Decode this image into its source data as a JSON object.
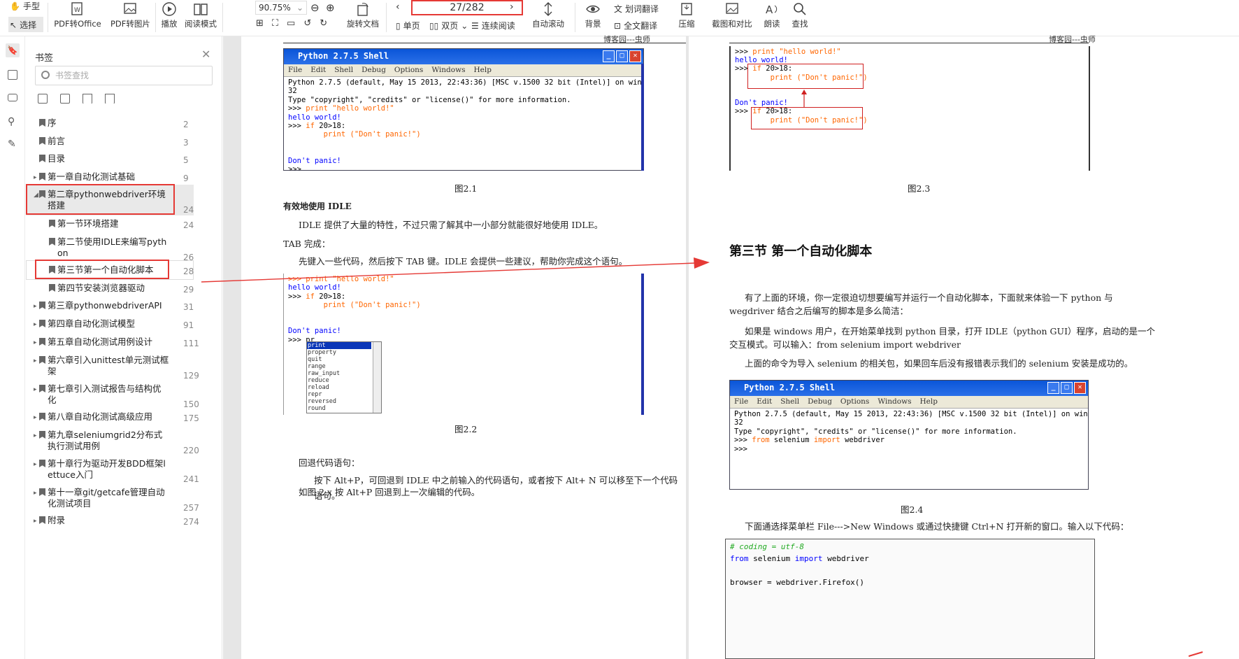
{
  "toolbar": {
    "hand": "手型",
    "select": "选择",
    "pdf_office": "PDF转Office",
    "pdf_img": "PDF转图片",
    "play": "播放",
    "read_mode": "阅读模式",
    "zoom": "90.75%",
    "rotate": "旋转文档",
    "page_indicator": "27/282",
    "single": "单页",
    "double": "双页",
    "continuous": "连续阅读",
    "auto_scroll": "自动滚动",
    "background": "背景",
    "word_translate": "划词翻译",
    "full_translate": "全文翻译",
    "compress": "压缩",
    "screenshot": "截图和对比",
    "read_aloud": "朗读",
    "find": "查找"
  },
  "panel": {
    "title": "书签",
    "search_placeholder": "书签查找",
    "bookmarks": [
      {
        "label": "序",
        "page": "2"
      },
      {
        "label": "前言",
        "page": "3"
      },
      {
        "label": "目录",
        "page": "5"
      },
      {
        "label": "第一章自动化测试基础",
        "page": "9"
      },
      {
        "label": "第二章pythonwebdriver环境",
        "label2": "搭建",
        "page": "24"
      },
      {
        "label": "第一节环境搭建",
        "page": "24"
      },
      {
        "label": "第二节使用IDLE来编写pyth",
        "label2": "on",
        "page": "26"
      },
      {
        "label": "第三节第一个自动化脚本",
        "page": "28"
      },
      {
        "label": "第四节安装浏览器驱动",
        "page": "29"
      },
      {
        "label": "第三章pythonwebdriverAPI",
        "page": "31"
      },
      {
        "label": "第四章自动化测试模型",
        "page": "91"
      },
      {
        "label": "第五章自动化测试用例设计",
        "page": "111"
      },
      {
        "label": "第六章引入unittest单元测试框",
        "label2": "架",
        "page": "129"
      },
      {
        "label": "第七章引入测试报告与结构优",
        "label2": "化",
        "page": "150"
      },
      {
        "label": "第八章自动化测试高级应用",
        "page": "175"
      },
      {
        "label": "第九章seleniumgrid2分布式",
        "label2": "执行测试用例",
        "page": "220"
      },
      {
        "label": "第十章行为驱动开发BDD框架l",
        "label2": "ettuce入门",
        "page": "241"
      },
      {
        "label": "第十一章git/getcafe管理自动",
        "label2": "化测试项目",
        "page": "257"
      },
      {
        "label": "附录",
        "page": "274"
      }
    ]
  },
  "left_page": {
    "header": "博客园---虫师",
    "shell_title": "Python 2.7.5 Shell",
    "menu": [
      "File",
      "Edit",
      "Shell",
      "Debug",
      "Options",
      "Windows",
      "Help"
    ],
    "shell1": {
      "l1": "Python 2.7.5 (default, May 15 2013, 22:43:36) [MSC v.1500 32 bit (Intel)] on win",
      "l2": "32",
      "l3": "Type \"copyright\", \"credits\" or \"license()\" for more information.",
      "p1": ">>> ",
      "c1": "print \"hello world!\"",
      "o1": "hello world!",
      "p2": ">>> ",
      "k2": "if ",
      "c2": "20>18:",
      "c3": "print (\"Don't panic!\")",
      "o2": "Don't panic!",
      "p3": ">>>"
    },
    "fig1": "图2.1",
    "section": "有效地使用 IDLE",
    "para1": "IDLE 提供了大量的特性，不过只需了解其中一小部分就能很好地使用 IDLE。",
    "para2": "TAB 完成：",
    "para3": "先键入一些代码，然后按下 TAB 键。IDLE 会提供一些建议，帮助你完成这个语句。",
    "shell2": {
      "l0": ">>> print \"hello world!\"",
      "o1": "hello world!",
      "p2": ">>> ",
      "k2": "if ",
      "c2": "20>18:",
      "c3": "print (\"Don't panic!\")",
      "o2": "Don't panic!",
      "p3": ">>> pr"
    },
    "completions": [
      "print",
      "property",
      "quit",
      "range",
      "raw_input",
      "reduce",
      "reload",
      "repr",
      "reversed",
      "round"
    ],
    "fig2": "图2.2",
    "para4": "回退代码语句：",
    "para5": "按下 Alt+P，可回退到 IDLE 中之前输入的代码语句，或者按下 Alt+ N 可以移至下一个代码语句。",
    "para6": "如图 2.x 按 Alt+P 回退到上一次编辑的代码。"
  },
  "right_page": {
    "header": "博客园---虫师",
    "shell3": {
      "p1": ">>> ",
      "c1": "print \"hello world!\"",
      "o1": "hello world!",
      "p2": ">>> ",
      "k2": "if ",
      "c2": "20>18:",
      "c3": "print (\"Don't panic!\")",
      "o2": "Don't panic!",
      "p3": ">>> ",
      "k3": "if ",
      "c4": "20>18:",
      "c5": "print (\"Don't panic!\")"
    },
    "fig3": "图2.3",
    "heading": "第三节   第一个自动化脚本",
    "para1": "有了上面的环境，你一定很迫切想要编写并运行一个自动化脚本，下面就来体验一下 python 与",
    "para1b": "wegdriver 结合之后编写的脚本是多么简洁：",
    "para2": "如果是 windows 用户，在开始菜单找到 python 目录，打开 IDLE（python GUI）程序，启动的是一个",
    "para2b": "交互模式。可以输入：from selenium import webdriver",
    "para3": "上面的命令为导入 selenium 的相关包，如果回车后没有报错表示我们的 selenium 安装是成功的。",
    "shell4": {
      "l1": "Python 2.7.5 (default, May 15 2013, 22:43:36) [MSC v.1500 32 bit (Intel)] on win",
      "l2": "32",
      "l3": "Type \"copyright\", \"credits\" or \"license()\" for more information.",
      "p1": ">>> ",
      "k1": "from ",
      "c1": "selenium ",
      "k2": "import ",
      "c2": "webdriver",
      "p2": ">>>"
    },
    "fig4": "图2.4",
    "para4": "下面通选择菜单栏 File--->New Windows 或通过快捷键 Ctrl+N 打开新的窗口。输入以下代码：",
    "code": {
      "l1": "# coding = utf-8",
      "k1": "from ",
      "c1": "selenium ",
      "k2": "import ",
      "c2": "webdriver",
      "l3": "browser = webdriver.Firefox()"
    }
  }
}
